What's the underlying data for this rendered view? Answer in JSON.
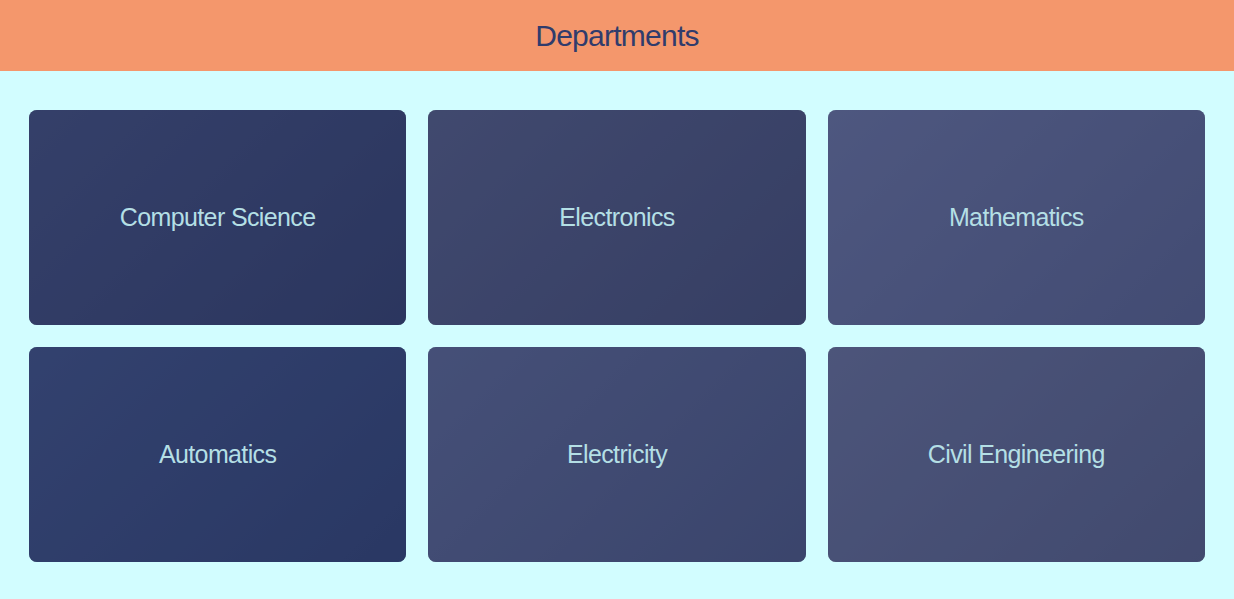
{
  "header": {
    "title": "Departments"
  },
  "departments": [
    {
      "name": "Computer Science"
    },
    {
      "name": "Electronics"
    },
    {
      "name": "Mathematics"
    },
    {
      "name": "Automatics"
    },
    {
      "name": "Electricity"
    },
    {
      "name": "Civil Engineering"
    }
  ]
}
